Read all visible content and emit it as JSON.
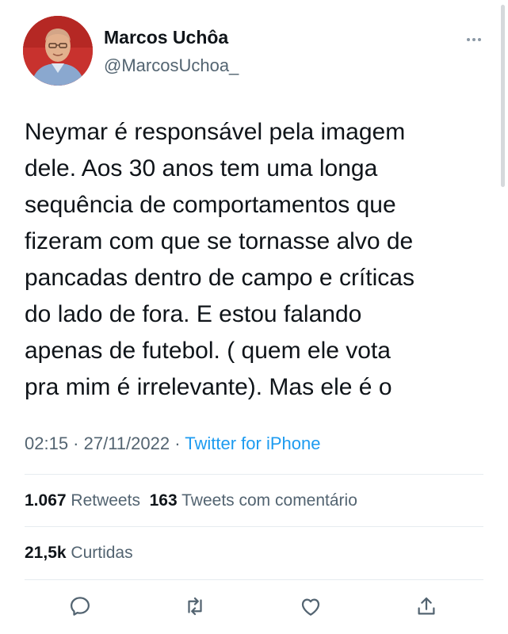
{
  "author": {
    "name": "Marcos Uchôa",
    "handle": "@MarcosUchoa_",
    "avatar_icon": "profile-photo"
  },
  "tweet": {
    "lines": [
      "Neymar é responsável pela imagem",
      "dele. Aos 30 anos tem uma longa",
      "sequência de comportamentos que",
      "fizeram com que se tornasse alvo de",
      "pancadas dentro de campo e críticas",
      "do lado de fora. E estou falando",
      "apenas de futebol. ( quem ele vota",
      "pra mim é irrelevante). Mas ele é o"
    ]
  },
  "meta": {
    "time": "02:15",
    "separator": " · ",
    "date": "27/11/2022",
    "source": "Twitter for iPhone"
  },
  "stats": {
    "retweets_count": "1.067",
    "retweets_label": "Retweets",
    "quotes_count": "163",
    "quotes_label": "Tweets com comentário",
    "likes_count": "21,5k",
    "likes_label": "Curtidas"
  },
  "actions": [
    {
      "icon": "reply-icon"
    },
    {
      "icon": "retweet-icon"
    },
    {
      "icon": "like-icon"
    },
    {
      "icon": "share-icon"
    }
  ],
  "colors": {
    "text": "#0f1419",
    "secondary": "#536471",
    "link": "#1d9bf0",
    "divider": "#e6ecf0"
  }
}
